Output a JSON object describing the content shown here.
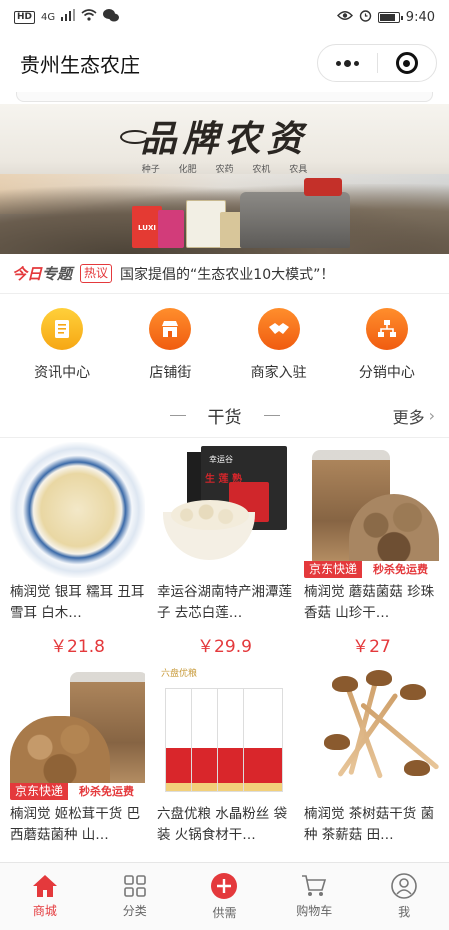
{
  "status_bar": {
    "hd": "HD",
    "network": "4G",
    "time": "9:40"
  },
  "header": {
    "title": "贵州生态农庄",
    "more_icon": "more-dots-icon",
    "close_icon": "target-close-icon"
  },
  "banner": {
    "title": "品牌农资",
    "subtitle": "种子 化肥 农药 农机 农具",
    "product_label": "LUXI"
  },
  "notice": {
    "tag_today": "今日",
    "tag_topic": "专题",
    "hot_label": "热议",
    "text": "国家提倡的“生态农业10大模式”！"
  },
  "menu": [
    {
      "label": "资讯中心",
      "icon": "news-icon",
      "color": "#f6b21d"
    },
    {
      "label": "店铺街",
      "icon": "store-icon",
      "color": "#f36a1c"
    },
    {
      "label": "商家入驻",
      "icon": "handshake-icon",
      "color": "#f36a1c"
    },
    {
      "label": "分销中心",
      "icon": "org-chart-icon",
      "color": "#f36a1c"
    }
  ],
  "section": {
    "title": "干货",
    "more_label": "更多"
  },
  "products": [
    {
      "name": "楠润觉 银耳 糯耳 丑耳 雪耳 白木…",
      "price": "￥21.8"
    },
    {
      "name": "幸运谷湖南特产湘潭莲子 去芯白莲…",
      "price": "￥29.9",
      "brand": "幸运谷",
      "product_text": "生 莲 熟"
    },
    {
      "name": "楠润觉 蘑菇菌菇 珍珠香菇 山珍干…",
      "price": "￥27",
      "badge_jd": "京东快递",
      "badge_sale": "秒杀免运费"
    },
    {
      "name": "楠润觉 姬松茸干货 巴西蘑菇菌种 山…",
      "badge_jd": "京东快递",
      "badge_sale": "秒杀免运费"
    },
    {
      "name": "六盘优粮 水晶粉丝 袋装 火锅食材干…",
      "logo_text": "六盘优粮"
    },
    {
      "name": "楠润觉 茶树菇干货 菌种 茶薪菇 田…"
    }
  ],
  "tabbar": [
    {
      "label": "商城",
      "icon": "home-icon",
      "active": true
    },
    {
      "label": "分类",
      "icon": "grid-icon",
      "active": false
    },
    {
      "label": "供需",
      "icon": "plus-circle-icon",
      "active": false
    },
    {
      "label": "购物车",
      "icon": "cart-icon",
      "active": false
    },
    {
      "label": "我",
      "icon": "user-icon",
      "active": false
    }
  ],
  "colors": {
    "accent": "#e4393c",
    "menu_yellow": "#f6b21d",
    "menu_orange": "#f36a1c"
  }
}
